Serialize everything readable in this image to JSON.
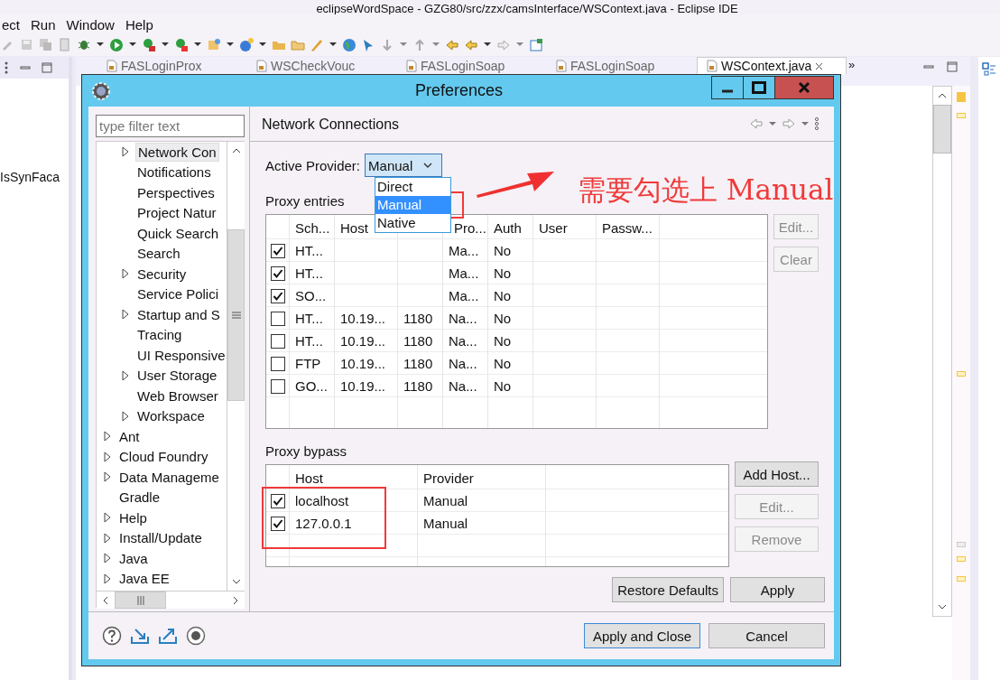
{
  "ide": {
    "title": "eclipseWordSpace - GZG80/src/zzx/camsInterface/WSContext.java - Eclipse IDE",
    "menu": [
      "ect",
      "Run",
      "Window",
      "Help"
    ],
    "editor_tabs": [
      {
        "label": "FASLoginProx",
        "selected": false
      },
      {
        "label": "WSCheckVouc",
        "selected": false
      },
      {
        "label": "FASLoginSoap",
        "selected": false
      },
      {
        "label": "FASLoginSoap",
        "selected": false
      },
      {
        "label": "WSContext.java",
        "selected": true
      }
    ],
    "tabs_overflow": "»",
    "editor_text": "IsSynFaca"
  },
  "dialog": {
    "title": "Preferences",
    "filter": {
      "placeholder": "type filter text"
    },
    "tree": [
      {
        "children": [
          {
            "label": "Network Con",
            "expandable": true,
            "selected": true
          },
          {
            "label": "Notifications",
            "expandable": false,
            "selected": false
          },
          {
            "label": "Perspectives",
            "expandable": false,
            "selected": false
          },
          {
            "label": "Project Natur",
            "expandable": false,
            "selected": false
          },
          {
            "label": "Quick Search",
            "expandable": false,
            "selected": false
          },
          {
            "label": "Search",
            "expandable": false,
            "selected": false
          },
          {
            "label": "Security",
            "expandable": true,
            "selected": false
          },
          {
            "label": "Service Polici",
            "expandable": false,
            "selected": false
          },
          {
            "label": "Startup and S",
            "expandable": true,
            "selected": false
          },
          {
            "label": "Tracing",
            "expandable": false,
            "selected": false
          },
          {
            "label": "UI Responsive",
            "expandable": false,
            "selected": false
          },
          {
            "label": "User Storage",
            "expandable": true,
            "selected": false
          },
          {
            "label": "Web Browser",
            "expandable": false,
            "selected": false
          },
          {
            "label": "Workspace",
            "expandable": true,
            "selected": false
          }
        ]
      },
      {
        "label": "Ant",
        "expandable": true,
        "selected": false
      },
      {
        "label": "Cloud Foundry",
        "expandable": true,
        "selected": false
      },
      {
        "label": "Data Manageme",
        "expandable": true,
        "selected": false
      },
      {
        "label": "Gradle",
        "expandable": false,
        "selected": false
      },
      {
        "label": "Help",
        "expandable": true,
        "selected": false
      },
      {
        "label": "Install/Update",
        "expandable": true,
        "selected": false
      },
      {
        "label": "Java",
        "expandable": true,
        "selected": false
      },
      {
        "label": "Java EE",
        "expandable": true,
        "selected": false
      }
    ],
    "page": {
      "title": "Network Connections",
      "active_provider": {
        "label": "Active Provider:",
        "value": "Manual",
        "options": [
          {
            "label": "Direct",
            "selected": false
          },
          {
            "label": "Manual",
            "selected": true
          },
          {
            "label": "Native",
            "selected": false
          }
        ]
      },
      "proxy_entries": {
        "label": "Proxy entries",
        "columns": [
          "Sch...",
          "Host",
          "Pro...",
          "Auth",
          "User",
          "Passw..."
        ],
        "rows": [
          {
            "checked": true,
            "scheme": "HT...",
            "provider": "Ma...",
            "auth": "No"
          },
          {
            "checked": true,
            "scheme": "HT...",
            "provider": "Ma...",
            "auth": "No"
          },
          {
            "checked": true,
            "scheme": "SO...",
            "provider": "Ma...",
            "auth": "No"
          },
          {
            "checked": false,
            "scheme": "HT...",
            "host": "10.19...",
            "port": "1180",
            "provider": "Na...",
            "auth": "No"
          },
          {
            "checked": false,
            "scheme": "HT...",
            "host": "10.19...",
            "port": "1180",
            "provider": "Na...",
            "auth": "No"
          },
          {
            "checked": false,
            "scheme": "FTP",
            "host": "10.19...",
            "port": "1180",
            "provider": "Na...",
            "auth": "No"
          },
          {
            "checked": false,
            "scheme": "GO...",
            "host": "10.19...",
            "port": "1180",
            "provider": "Na...",
            "auth": "No"
          }
        ],
        "buttons": [
          {
            "label": "Edit...",
            "disabled": true
          },
          {
            "label": "Clear",
            "disabled": true
          }
        ]
      },
      "proxy_bypass": {
        "label": "Proxy bypass",
        "columns": [
          "Host",
          "Provider"
        ],
        "rows": [
          {
            "checked": true,
            "host": "localhost",
            "provider": "Manual"
          },
          {
            "checked": true,
            "host": "127.0.0.1",
            "provider": "Manual"
          }
        ],
        "buttons": [
          {
            "label": "Add Host...",
            "disabled": false
          },
          {
            "label": "Edit...",
            "disabled": true
          },
          {
            "label": "Remove",
            "disabled": true
          }
        ]
      },
      "buttons": [
        "Restore Defaults",
        "Apply"
      ]
    },
    "footer_buttons": [
      {
        "label": "Apply and Close",
        "default": true
      },
      {
        "label": "Cancel",
        "default": false
      }
    ]
  },
  "annotation": {
    "text": "需要勾选上 Manual"
  }
}
